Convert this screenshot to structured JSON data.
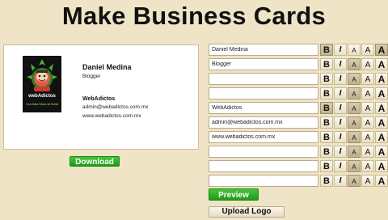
{
  "page": {
    "title": "Make Business Cards"
  },
  "card": {
    "logo": {
      "name": "webAdictos",
      "tagline": "Una Mala Diaria de Moldt"
    },
    "name": "Daniel Medina",
    "job_title": "Blogger",
    "company": "WebAdictos",
    "email": "admin@webadictos.com.mx",
    "website": "www.webadictos.com.mx"
  },
  "buttons": {
    "download": "Download",
    "preview": "Preview",
    "upload_logo": "Upload Logo"
  },
  "format_labels": {
    "bold": "B",
    "italic": "I",
    "small": "A",
    "medium": "A",
    "large": "A"
  },
  "rows": [
    {
      "value": "Daniel Medina",
      "bold": true,
      "italic": false,
      "size": "large"
    },
    {
      "value": "Blogger",
      "bold": false,
      "italic": false,
      "size": "small"
    },
    {
      "value": "",
      "bold": false,
      "italic": false,
      "size": "small"
    },
    {
      "value": "",
      "bold": false,
      "italic": false,
      "size": "small"
    },
    {
      "value": "WebAdictos",
      "bold": true,
      "italic": false,
      "size": "small"
    },
    {
      "value": "admin@webadictos.com.mx",
      "bold": false,
      "italic": false,
      "size": "small"
    },
    {
      "value": "www.webadictos.com.mx",
      "bold": false,
      "italic": false,
      "size": "small"
    },
    {
      "value": "",
      "bold": false,
      "italic": false,
      "size": "small"
    },
    {
      "value": "",
      "bold": false,
      "italic": false,
      "size": "small"
    },
    {
      "value": "",
      "bold": false,
      "italic": false,
      "size": "small"
    }
  ]
}
